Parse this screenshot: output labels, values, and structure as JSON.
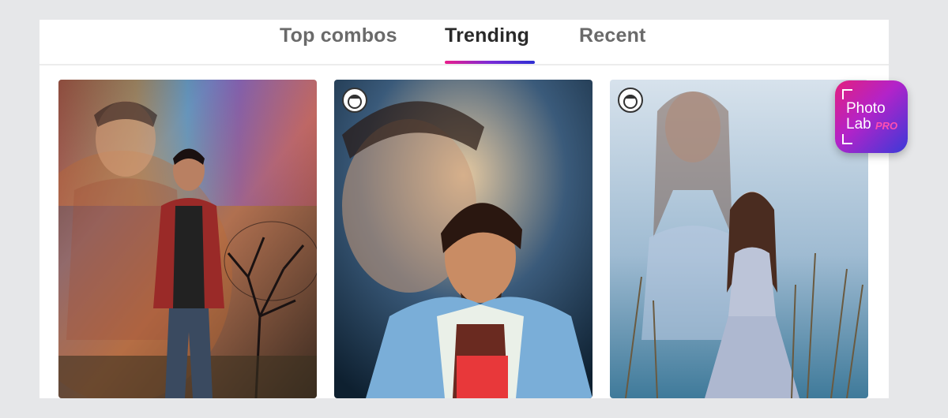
{
  "tabs": [
    {
      "label": "Top combos",
      "selected": false
    },
    {
      "label": "Trending",
      "selected": true
    },
    {
      "label": "Recent",
      "selected": false
    }
  ],
  "colors": {
    "tab_underline": [
      "#e91e8c",
      "#7b2bd6",
      "#2e2fd3"
    ],
    "background": "#e6e7e9"
  },
  "cards": [
    {
      "icon": null
    },
    {
      "icon": "face-icon"
    },
    {
      "icon": "face-icon"
    }
  ],
  "logo": {
    "line1": "Photo",
    "line2": "Lab",
    "badge": "PRO"
  }
}
